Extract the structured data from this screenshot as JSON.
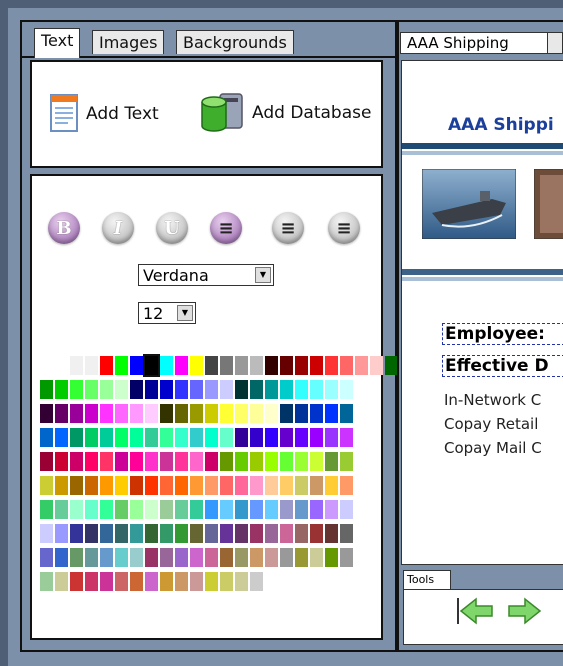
{
  "tabs": [
    {
      "label": "Text",
      "active": true
    },
    {
      "label": "Images",
      "active": false
    },
    {
      "label": "Backgrounds",
      "active": false
    }
  ],
  "actions": {
    "add_text": "Add Text",
    "add_database": "Add Database"
  },
  "format_buttons": [
    {
      "glyph": "B",
      "name": "bold",
      "active": true
    },
    {
      "glyph": "I",
      "name": "italic",
      "active": false
    },
    {
      "glyph": "U",
      "name": "underline",
      "active": false
    },
    {
      "glyph": "≡",
      "name": "align-left",
      "active": true
    },
    {
      "glyph": "≡",
      "name": "align-center",
      "active": false
    },
    {
      "glyph": "≡",
      "name": "align-right",
      "active": false
    }
  ],
  "font_family": {
    "value": "Verdana"
  },
  "font_size": {
    "value": "12"
  },
  "palette_rows": [
    [
      "#f0f0f0",
      "#f0f0f0",
      "#ff0000",
      "#00ff00",
      "#0000ff",
      "#000000",
      "#00ffff",
      "#ff00ff",
      "#ffff00",
      "#444444",
      "#777777",
      "#999999",
      "#bbbbbb",
      "#330000",
      "#660000",
      "#990000",
      "#cc0000",
      "#ff3333",
      "#ff6666",
      "#ff9999",
      "#ffcccc",
      "#006600",
      "#009900"
    ],
    [
      "#009900",
      "#00cc00",
      "#33ff33",
      "#66ff66",
      "#99ff99",
      "#ccffcc",
      "#000066",
      "#000099",
      "#0000cc",
      "#3333ff",
      "#6666ff",
      "#9999ff",
      "#ccccff",
      "#003333",
      "#006666",
      "#009999",
      "#00cccc",
      "#33ffff",
      "#66ffff",
      "#99ffff",
      "#ccffff"
    ],
    [
      "#330033",
      "#660066",
      "#990099",
      "#cc00cc",
      "#ff33ff",
      "#ff66ff",
      "#ff99ff",
      "#ffccff",
      "#333300",
      "#666600",
      "#999900",
      "#cccc00",
      "#ffff33",
      "#ffff66",
      "#ffff99",
      "#ffffcc",
      "#003366",
      "#003399",
      "#0033cc",
      "#0033ff",
      "#006699"
    ],
    [
      "#0066cc",
      "#0066ff",
      "#009966",
      "#00cc66",
      "#00cc99",
      "#00ff66",
      "#00ff99",
      "#33cc99",
      "#33ff99",
      "#33ffcc",
      "#33cccc",
      "#00ffcc",
      "#66ffcc",
      "#330099",
      "#3300cc",
      "#3300ff",
      "#6600cc",
      "#6600ff",
      "#9900ff",
      "#9933ff",
      "#cc33ff"
    ],
    [
      "#990033",
      "#cc0033",
      "#cc0066",
      "#ff0066",
      "#ff3366",
      "#cc0099",
      "#ff0099",
      "#ff33cc",
      "#cc3399",
      "#ff3399",
      "#ff66cc",
      "#cc0066",
      "#669900",
      "#66cc00",
      "#99cc00",
      "#99ff00",
      "#66ff33",
      "#99ff33",
      "#ccff33",
      "#669933",
      "#99cc33"
    ],
    [
      "#cccc33",
      "#cc9900",
      "#996600",
      "#cc6600",
      "#ff9900",
      "#ffcc00",
      "#cc3300",
      "#ff3300",
      "#ff6633",
      "#ff6600",
      "#ff9933",
      "#ff9966",
      "#ff6666",
      "#ff6699",
      "#ff99cc",
      "#ffcc99",
      "#ffcc66",
      "#cccc66",
      "#cc9966",
      "#ffcc33",
      "#ff9966"
    ],
    [
      "#33cc66",
      "#66cc99",
      "#99ffcc",
      "#66ffcc",
      "#33ff99",
      "#66cc66",
      "#99ff99",
      "#ccffcc",
      "#99cc99",
      "#66cc99",
      "#33cc99",
      "#3399ff",
      "#66ccff",
      "#3399cc",
      "#6699ff",
      "#66ccff",
      "#9999cc",
      "#6699cc",
      "#9966ff",
      "#cc99ff",
      "#ccccff"
    ],
    [
      "#ccccff",
      "#9999ff",
      "#333399",
      "#333366",
      "#336699",
      "#336666",
      "#339999",
      "#336633",
      "#339966",
      "#339933",
      "#666633",
      "#666699",
      "#663399",
      "#663366",
      "#993366",
      "#996699",
      "#cc6699",
      "#996666",
      "#993333",
      "#663333",
      "#666666"
    ],
    [
      "#6666cc",
      "#3366cc",
      "#669966",
      "#669999",
      "#6699cc",
      "#66cccc",
      "#99cccc",
      "#993366",
      "#996699",
      "#9966cc",
      "#cc66cc",
      "#cc6699",
      "#996633",
      "#999966",
      "#cc9966",
      "#cc9999",
      "#999999",
      "#999933",
      "#cccc99",
      "#669900",
      "#999999"
    ],
    [
      "#99cc99",
      "#cccc99",
      "#cc3333",
      "#cc3366",
      "#cc3399",
      "#cc6666",
      "#cc6633",
      "#cc66cc",
      "#cc9933",
      "#cc9966",
      "#cc9999",
      "#cccc33",
      "#cccc66",
      "#cccc99",
      "#cccccc"
    ]
  ],
  "document": {
    "url": "AAA Shipping",
    "title": "AAA Shippi",
    "fields": [
      "Employee:",
      "Effective D"
    ],
    "lines": [
      "In-Network C",
      "Copay Retail",
      "Copay Mail C"
    ]
  },
  "tools": {
    "tab_label": "Tools"
  }
}
